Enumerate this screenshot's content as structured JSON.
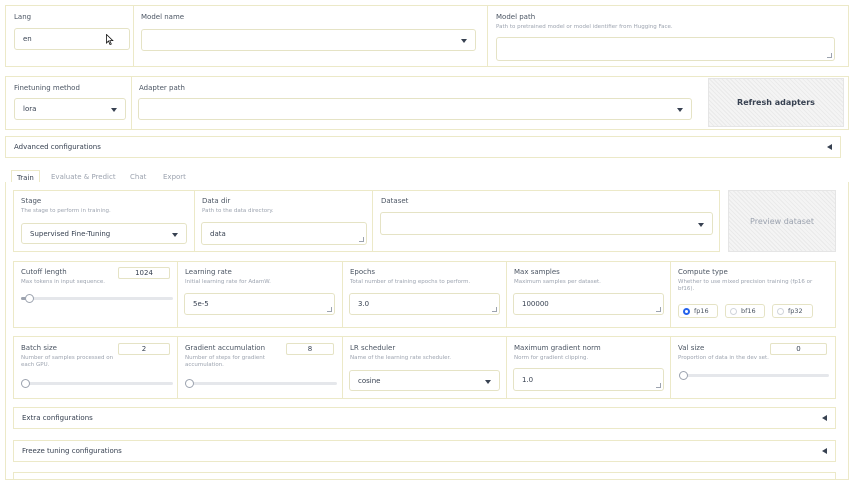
{
  "top": {
    "lang": {
      "label": "Lang",
      "value": "en"
    },
    "model_name": {
      "label": "Model name",
      "value": ""
    },
    "model_path": {
      "label": "Model path",
      "info": "Path to pretrained model or model identifier from Hugging Face.",
      "value": ""
    }
  },
  "row2": {
    "finetuning_method": {
      "label": "Finetuning method",
      "value": "lora"
    },
    "adapter_path": {
      "label": "Adapter path",
      "value": ""
    },
    "refresh_button": "Refresh adapters"
  },
  "advanced": {
    "label": "Advanced configurations"
  },
  "tabs": [
    "Train",
    "Evaluate & Predict",
    "Chat",
    "Export"
  ],
  "train": {
    "stage": {
      "label": "Stage",
      "info": "The stage to perform in training.",
      "value": "Supervised Fine-Tuning"
    },
    "data_dir": {
      "label": "Data dir",
      "info": "Path to the data directory.",
      "value": "data"
    },
    "dataset": {
      "label": "Dataset",
      "value": ""
    },
    "preview_button": "Preview dataset",
    "cutoff_len": {
      "label": "Cutoff length",
      "info": "Max tokens in input sequence.",
      "value": "1024",
      "fraction": 0.03
    },
    "learning_rate": {
      "label": "Learning rate",
      "info": "Initial learning rate for AdamW.",
      "value": "5e-5"
    },
    "epochs": {
      "label": "Epochs",
      "info": "Total number of training epochs to perform.",
      "value": "3.0"
    },
    "max_samples": {
      "label": "Max samples",
      "info": "Maximum samples per dataset.",
      "value": "100000"
    },
    "compute_type": {
      "label": "Compute type",
      "info_line1": "Whether to use mixed precision training (fp16 or",
      "info_line2": "bf16).",
      "options": [
        "fp16",
        "bf16",
        "fp32"
      ],
      "selected": "fp16"
    },
    "batch_size": {
      "label": "Batch size",
      "info_line1": "Number of samples processed on",
      "info_line2": "each GPU.",
      "value": "2",
      "fraction": 0.0
    },
    "grad_accum": {
      "label": "Gradient accumulation",
      "info_line1": "Number of steps for gradient",
      "info_line2": "accumulation.",
      "value": "8",
      "fraction": 0.0
    },
    "lr_scheduler": {
      "label": "LR scheduler",
      "info": "Name of the learning rate scheduler.",
      "value": "cosine"
    },
    "max_grad_norm": {
      "label": "Maximum gradient norm",
      "info": "Norm for gradient clipping.",
      "value": "1.0"
    },
    "val_size": {
      "label": "Val size",
      "info": "Proportion of data in the dev set.",
      "value": "0",
      "fraction": 0.0
    },
    "extra": {
      "label": "Extra configurations"
    },
    "freeze": {
      "label": "Freeze tuning configurations"
    }
  }
}
